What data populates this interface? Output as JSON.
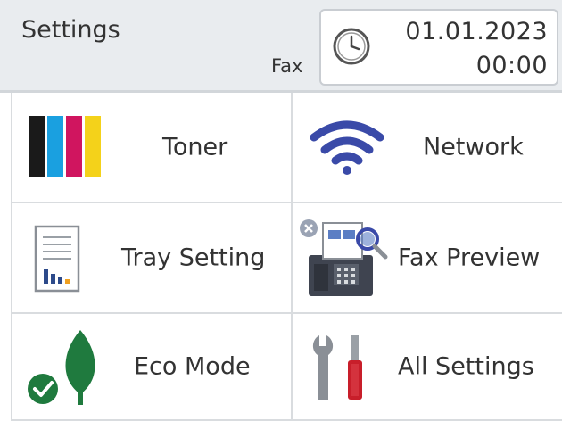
{
  "header": {
    "title": "Settings",
    "mode": "Fax",
    "date": "01.01.2023",
    "time": "00:00"
  },
  "tiles": [
    {
      "label": "Toner",
      "icon": "toner-icon"
    },
    {
      "label": "Network",
      "icon": "wifi-icon"
    },
    {
      "label": "Tray Setting",
      "icon": "tray-setting-icon"
    },
    {
      "label": "Fax Preview",
      "icon": "fax-preview-icon"
    },
    {
      "label": "Eco Mode",
      "icon": "eco-mode-icon"
    },
    {
      "label": "All Settings",
      "icon": "tools-icon"
    }
  ],
  "colors": {
    "header_bg": "#e9ecef",
    "toner_black": "#1a1a1a",
    "toner_cyan": "#1aa0e0",
    "toner_magenta": "#d0155f",
    "toner_yellow": "#f4d21a",
    "wifi_blue": "#3a4aa8",
    "eco_green": "#1f7a3e"
  }
}
